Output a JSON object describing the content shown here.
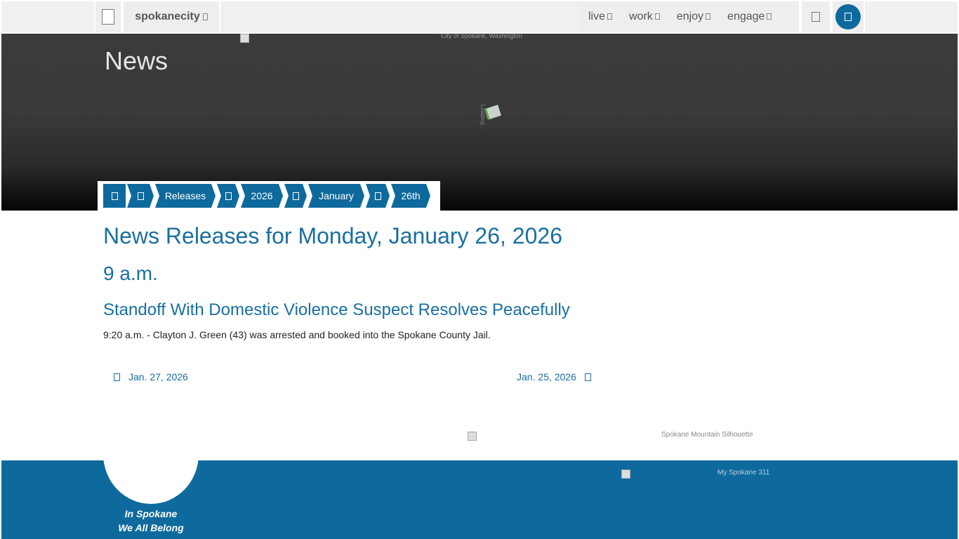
{
  "nav": {
    "brand": "spokanecity",
    "links": [
      {
        "label": "live"
      },
      {
        "label": "work"
      },
      {
        "label": "enjoy"
      },
      {
        "label": "engage"
      }
    ]
  },
  "hero": {
    "title": "News",
    "image_alt": "City of Spokane, Washington",
    "flag_alt": "Loading..."
  },
  "breadcrumb": {
    "items": [
      "Releases",
      "2026",
      "January",
      "26th"
    ]
  },
  "content": {
    "heading": "News Releases for Monday, January 26, 2026",
    "time_heading": "9 a.m.",
    "article_title": "Standoff With Domestic Violence Suspect Resolves Peacefully",
    "article_summary": "9:20 a.m. - Clayton J. Green (43) was arrested and booked into the Spokane County Jail."
  },
  "pager": {
    "prev": "Jan. 27, 2026",
    "next": "Jan. 25, 2026"
  },
  "silhouette_alt": "Spokane Mountain Silhouette",
  "footer": {
    "tagline_line1": "In Spokane",
    "tagline_line2": "We All Belong",
    "image_alt": "My Spokane 311"
  },
  "colors": {
    "primary": "#0e6a9c",
    "link": "#1a6fa0",
    "nav_bg": "#eeeeee"
  }
}
